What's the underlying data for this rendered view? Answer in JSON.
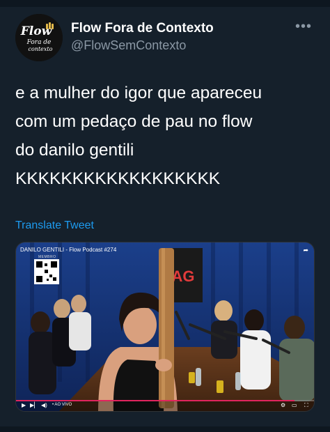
{
  "author": {
    "name": "Flow Fora de Contexto",
    "handle": "@FlowSemContexto",
    "avatar_logo_text": [
      "Flow",
      "Fora de",
      "contexto"
    ]
  },
  "menu": {
    "more_icon": "more-horizontal-icon",
    "glyph": "•••"
  },
  "tweet": {
    "lines": [
      "e a mulher do igor que apareceu",
      "com um pedaço de pau no flow",
      "do danilo gentili",
      "KKKKKKKKKKKKKKKKKK"
    ],
    "translate_label": "Translate Tweet"
  },
  "media": {
    "video_title": "DANILO GENTILI - Flow Podcast #274",
    "member_label": "MEMBRO",
    "sign_text": "AG",
    "live_label": "• AO VIVO"
  },
  "colors": {
    "background": "#15202b",
    "link": "#1d9bf0",
    "secondary_text": "#8b98a5",
    "progress": "#e0245e"
  }
}
